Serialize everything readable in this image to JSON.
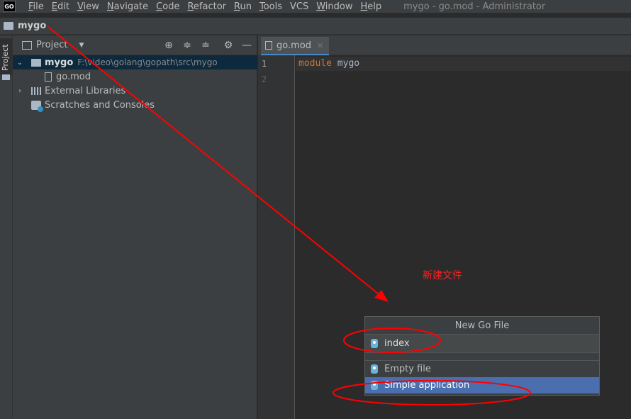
{
  "menubar": {
    "logo": "GO",
    "items": [
      {
        "mnemonic": "F",
        "rest": "ile"
      },
      {
        "mnemonic": "E",
        "rest": "dit"
      },
      {
        "mnemonic": "V",
        "rest": "iew"
      },
      {
        "mnemonic": "N",
        "rest": "avigate"
      },
      {
        "mnemonic": "C",
        "rest": "ode"
      },
      {
        "mnemonic": "R",
        "rest": "efactor"
      },
      {
        "mnemonic": "R",
        "rest": "un"
      },
      {
        "mnemonic": "T",
        "rest": "ools"
      },
      {
        "mnemonic": "",
        "rest": "VCS"
      },
      {
        "mnemonic": "W",
        "rest": "indow"
      },
      {
        "mnemonic": "H",
        "rest": "elp"
      }
    ],
    "window_title": "mygo - go.mod - Administrator"
  },
  "navbar": {
    "project": "mygo"
  },
  "side": {
    "tab_label": "Project"
  },
  "project_panel": {
    "title": "Project",
    "tree": {
      "root_name": "mygo",
      "root_path": "F:\\video\\golang\\gopath\\src\\mygo",
      "file": "go.mod",
      "external": "External Libraries",
      "scratches": "Scratches and Consoles"
    }
  },
  "editor": {
    "tab_label": "go.mod",
    "line_numbers": [
      "1",
      "2"
    ],
    "code": {
      "keyword": "module",
      "name": "mygo"
    }
  },
  "popup": {
    "title": "New Go File",
    "input_value": "index",
    "items": [
      "Empty file",
      "Simple application"
    ]
  },
  "annotation": {
    "text": "新建文件",
    "color": "#ff2020"
  },
  "colors": {
    "accent": "#4b6eaf",
    "annotation": "#ff0000",
    "keyword": "#cc7832"
  }
}
